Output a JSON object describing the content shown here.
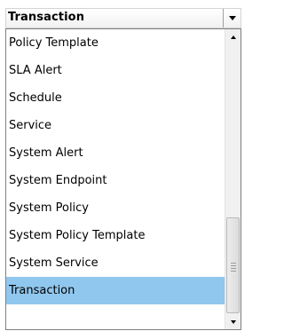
{
  "combo": {
    "selected_value": "Transaction",
    "dropdown_icon": "triangle-down-icon"
  },
  "list": {
    "items": [
      {
        "label": "Policy Template",
        "selected": false
      },
      {
        "label": "SLA Alert",
        "selected": false
      },
      {
        "label": "Schedule",
        "selected": false
      },
      {
        "label": "Service",
        "selected": false
      },
      {
        "label": "System Alert",
        "selected": false
      },
      {
        "label": "System Endpoint",
        "selected": false
      },
      {
        "label": "System Policy",
        "selected": false
      },
      {
        "label": "System Policy Template",
        "selected": false
      },
      {
        "label": "System Service",
        "selected": false
      },
      {
        "label": "Transaction",
        "selected": true
      }
    ]
  },
  "scrollbar": {
    "up_icon": "scroll-up-arrow-icon",
    "down_icon": "scroll-down-arrow-icon",
    "thumb_icon": "scroll-grip-icon"
  },
  "colors": {
    "selected_background": "#8fc7ee",
    "border": "#7f7f7f"
  }
}
